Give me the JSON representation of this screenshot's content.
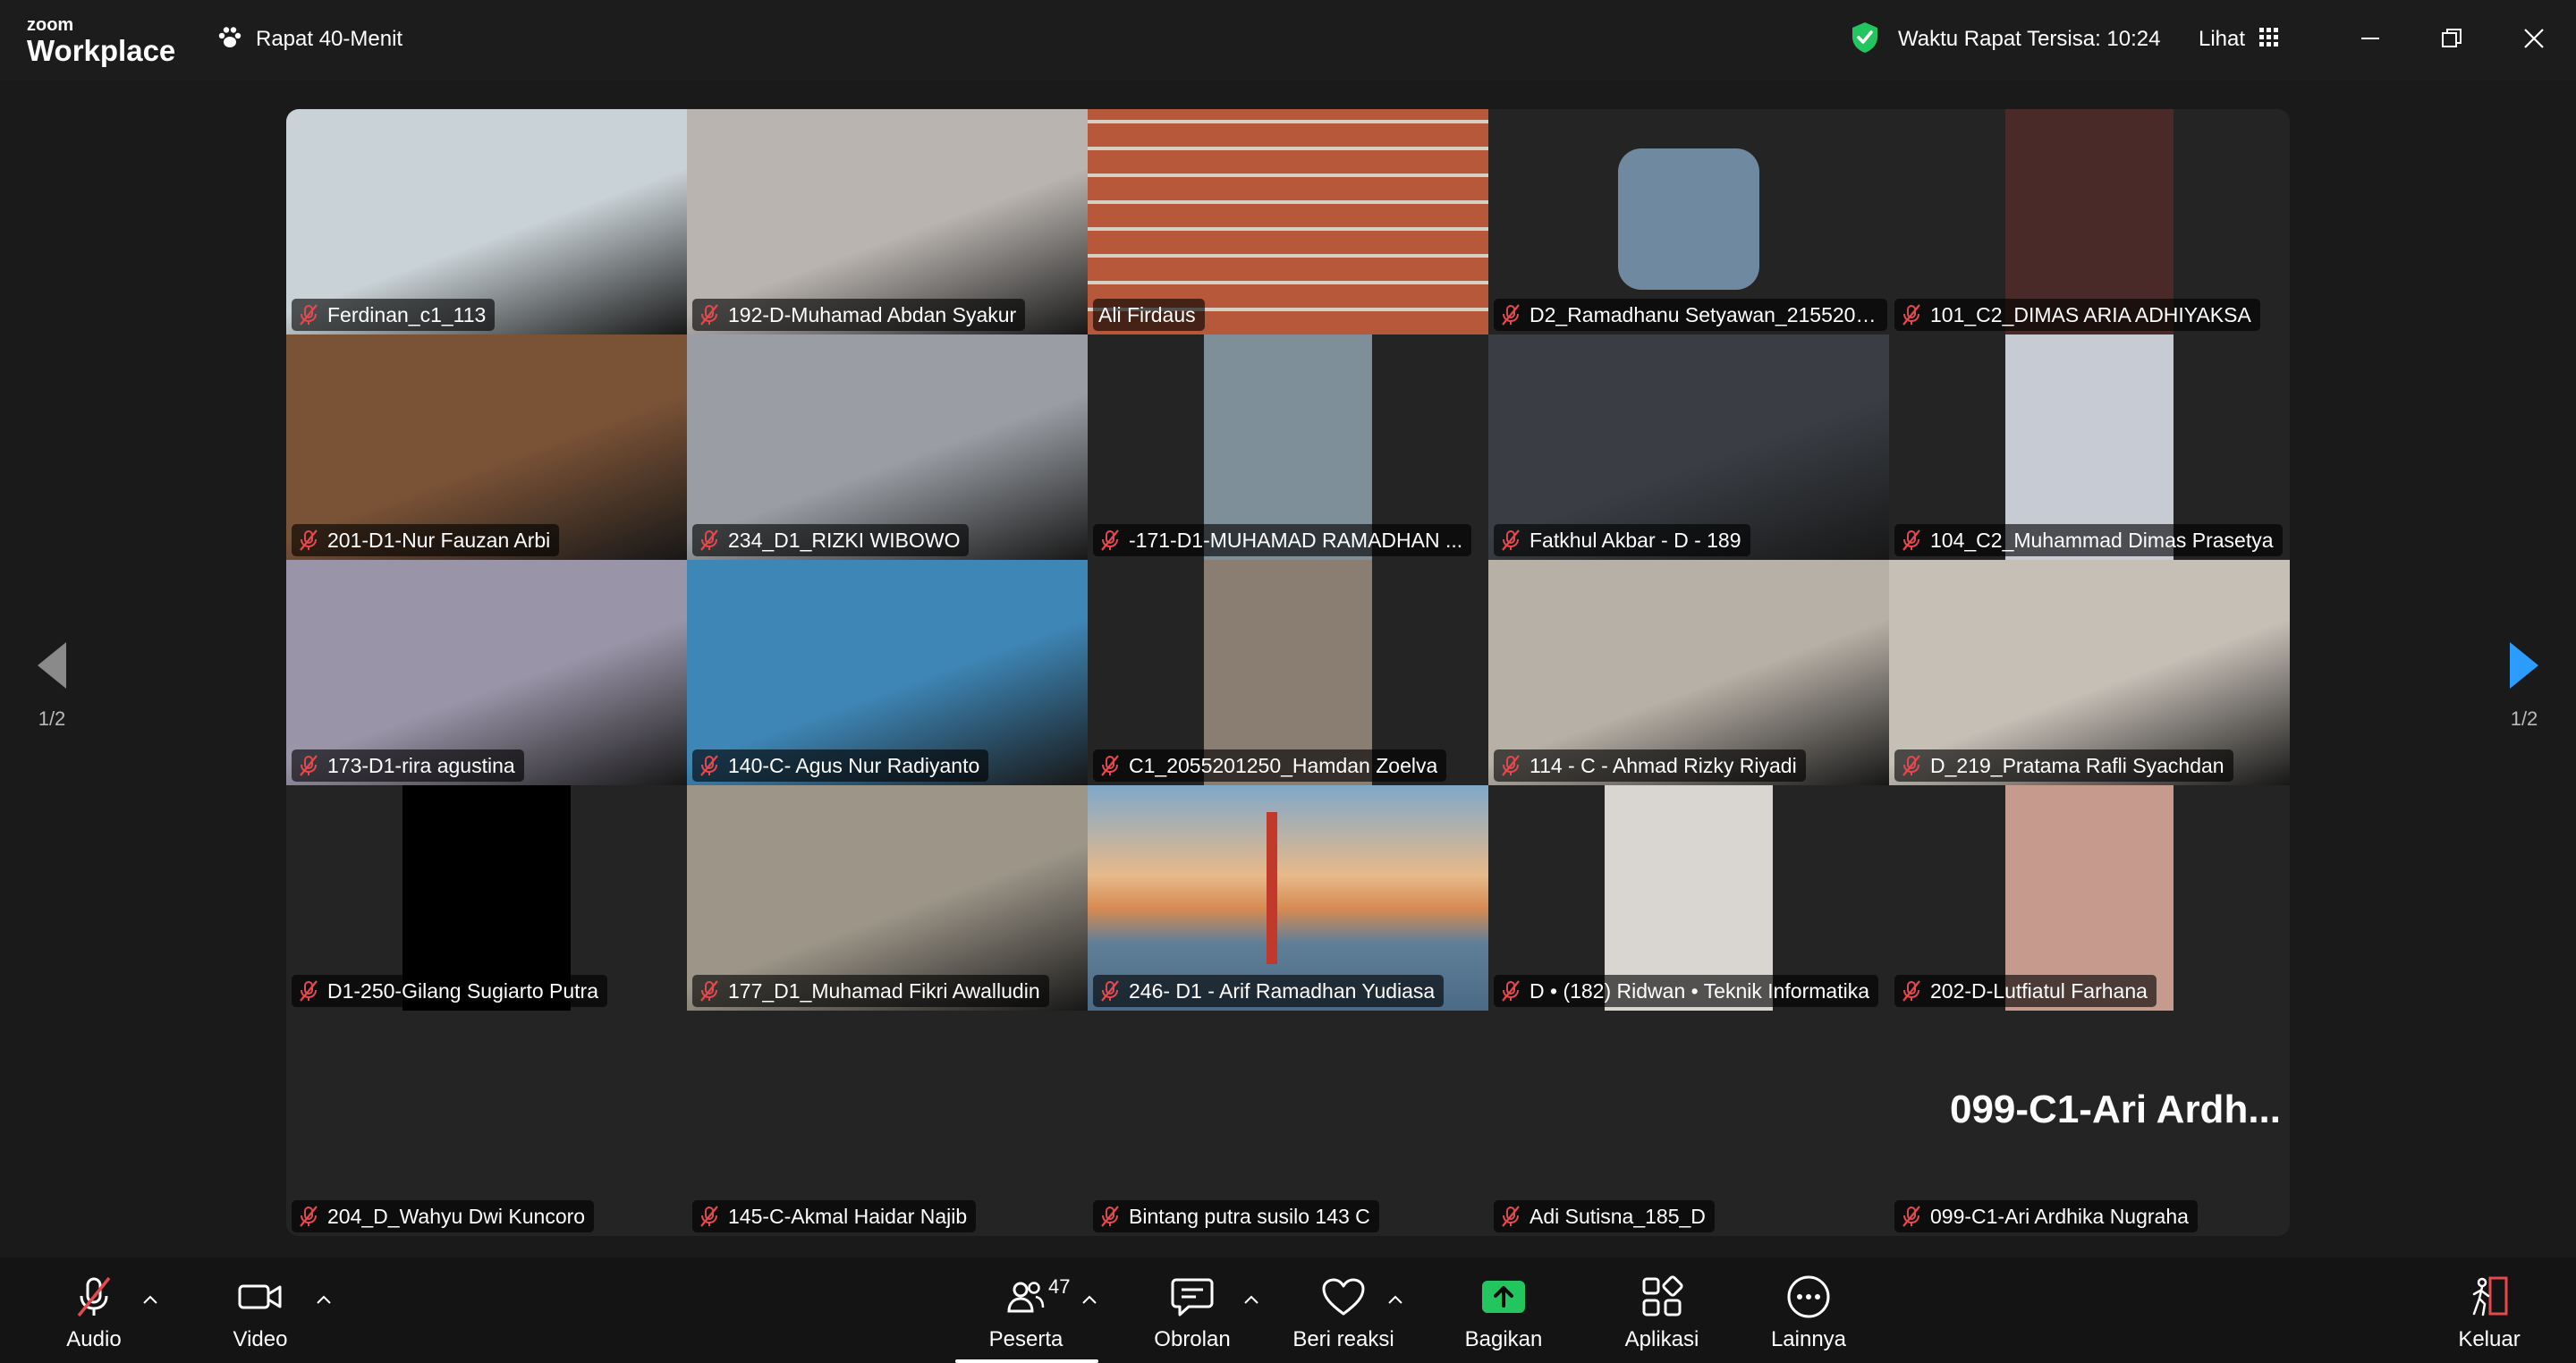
{
  "app": {
    "logo_top": "zoom",
    "logo_bottom": "Workplace"
  },
  "meeting": {
    "title": "Rapat 40-Menit"
  },
  "header": {
    "timer": "Waktu Rapat Tersisa: 10:24",
    "view_label": "Lihat"
  },
  "pager": {
    "left_page": "1/2",
    "right_page": "1/2"
  },
  "colors": {
    "active_speaker": "#2ee37a",
    "share_green": "#22c55e",
    "muted_red": "#e5484d",
    "leave_red": "#e5484d",
    "next_arrow": "#2d9cff"
  },
  "participants": [
    {
      "name": "Ferdinan_c1_113",
      "muted": true,
      "video": "full",
      "bg": "#c9d2d6"
    },
    {
      "name": "192-D-Muhamad Abdan Syakur",
      "muted": true,
      "video": "full",
      "bg": "#b9b4b0"
    },
    {
      "name": "Ali Firdaus",
      "muted": false,
      "video": "full",
      "bg": "#b8583a",
      "active": true
    },
    {
      "name": "D2_Ramadhanu Setyawan_2155201...",
      "muted": true,
      "video": "avatar",
      "bg": "#6f8aa0"
    },
    {
      "name": "101_C2_DIMAS ARIA ADHIYAKSA",
      "muted": true,
      "video": "mid",
      "bg": "#4a2a28"
    },
    {
      "name": "201-D1-Nur Fauzan Arbi",
      "muted": true,
      "video": "full",
      "bg": "#7a5236"
    },
    {
      "name": "234_D1_RIZKI WIBOWO",
      "muted": true,
      "video": "full",
      "bg": "#9a9ea4"
    },
    {
      "name": "-171-D1-MUHAMAD RAMADHAN ...",
      "muted": true,
      "video": "mid",
      "bg": "#7e8f9a"
    },
    {
      "name": "Fatkhul Akbar - D - 189",
      "muted": true,
      "video": "full",
      "bg": "#3a3e44"
    },
    {
      "name": "104_C2_Muhammad Dimas Prasetya",
      "muted": true,
      "video": "mid",
      "bg": "#c7ccd4"
    },
    {
      "name": "173-D1-rira agustina",
      "muted": true,
      "video": "full",
      "bg": "#9a94a8"
    },
    {
      "name": "140-C- Agus Nur Radiyanto",
      "muted": true,
      "video": "full",
      "bg": "#3e86b6"
    },
    {
      "name": "C1_2055201250_Hamdan Zoelva",
      "muted": true,
      "video": "mid",
      "bg": "#8a7d72"
    },
    {
      "name": "114 - C - Ahmad Rizky Riyadi",
      "muted": true,
      "video": "full",
      "bg": "#b7b0a6"
    },
    {
      "name": "D_219_Pratama Rafli Syachdan",
      "muted": true,
      "video": "full",
      "bg": "#c6bfb6"
    },
    {
      "name": "D1-250-Gilang Sugiarto Putra",
      "muted": true,
      "video": "mid",
      "bg": "#000000"
    },
    {
      "name": "177_D1_Muhamad Fikri Awalludin",
      "muted": true,
      "video": "full",
      "bg": "#9c9588"
    },
    {
      "name": "246- D1 - Arif Ramadhan Yudiasa",
      "muted": true,
      "video": "bridge",
      "bg": "#d68a52"
    },
    {
      "name": "D • (182) Ridwan • Teknik Informatika",
      "muted": true,
      "video": "mid",
      "bg": "#d9d6d2"
    },
    {
      "name": "202-D-Lutfiatul Farhana",
      "muted": true,
      "video": "mid",
      "bg": "#c79a8e"
    },
    {
      "name": "204_D_Wahyu Dwi Kuncoro",
      "muted": true,
      "video": "none",
      "bg": "#242424"
    },
    {
      "name": "145-C-Akmal Haidar Najib",
      "muted": true,
      "video": "none",
      "bg": "#242424"
    },
    {
      "name": "Bintang putra susilo 143 C",
      "muted": true,
      "video": "none",
      "bg": "#242424"
    },
    {
      "name": "Adi Sutisna_185_D",
      "muted": true,
      "video": "none",
      "bg": "#242424"
    },
    {
      "name": "099-C1-Ari Ardhika Nugraha",
      "muted": true,
      "video": "none",
      "bg": "#242424",
      "big_name": "099-C1-Ari  Ardh..."
    }
  ],
  "toolbar": {
    "audio": "Audio",
    "video": "Video",
    "participants": "Peserta",
    "participants_count": "47",
    "chat": "Obrolan",
    "react": "Beri reaksi",
    "share": "Bagikan",
    "apps": "Aplikasi",
    "more": "Lainnya",
    "leave": "Keluar"
  }
}
